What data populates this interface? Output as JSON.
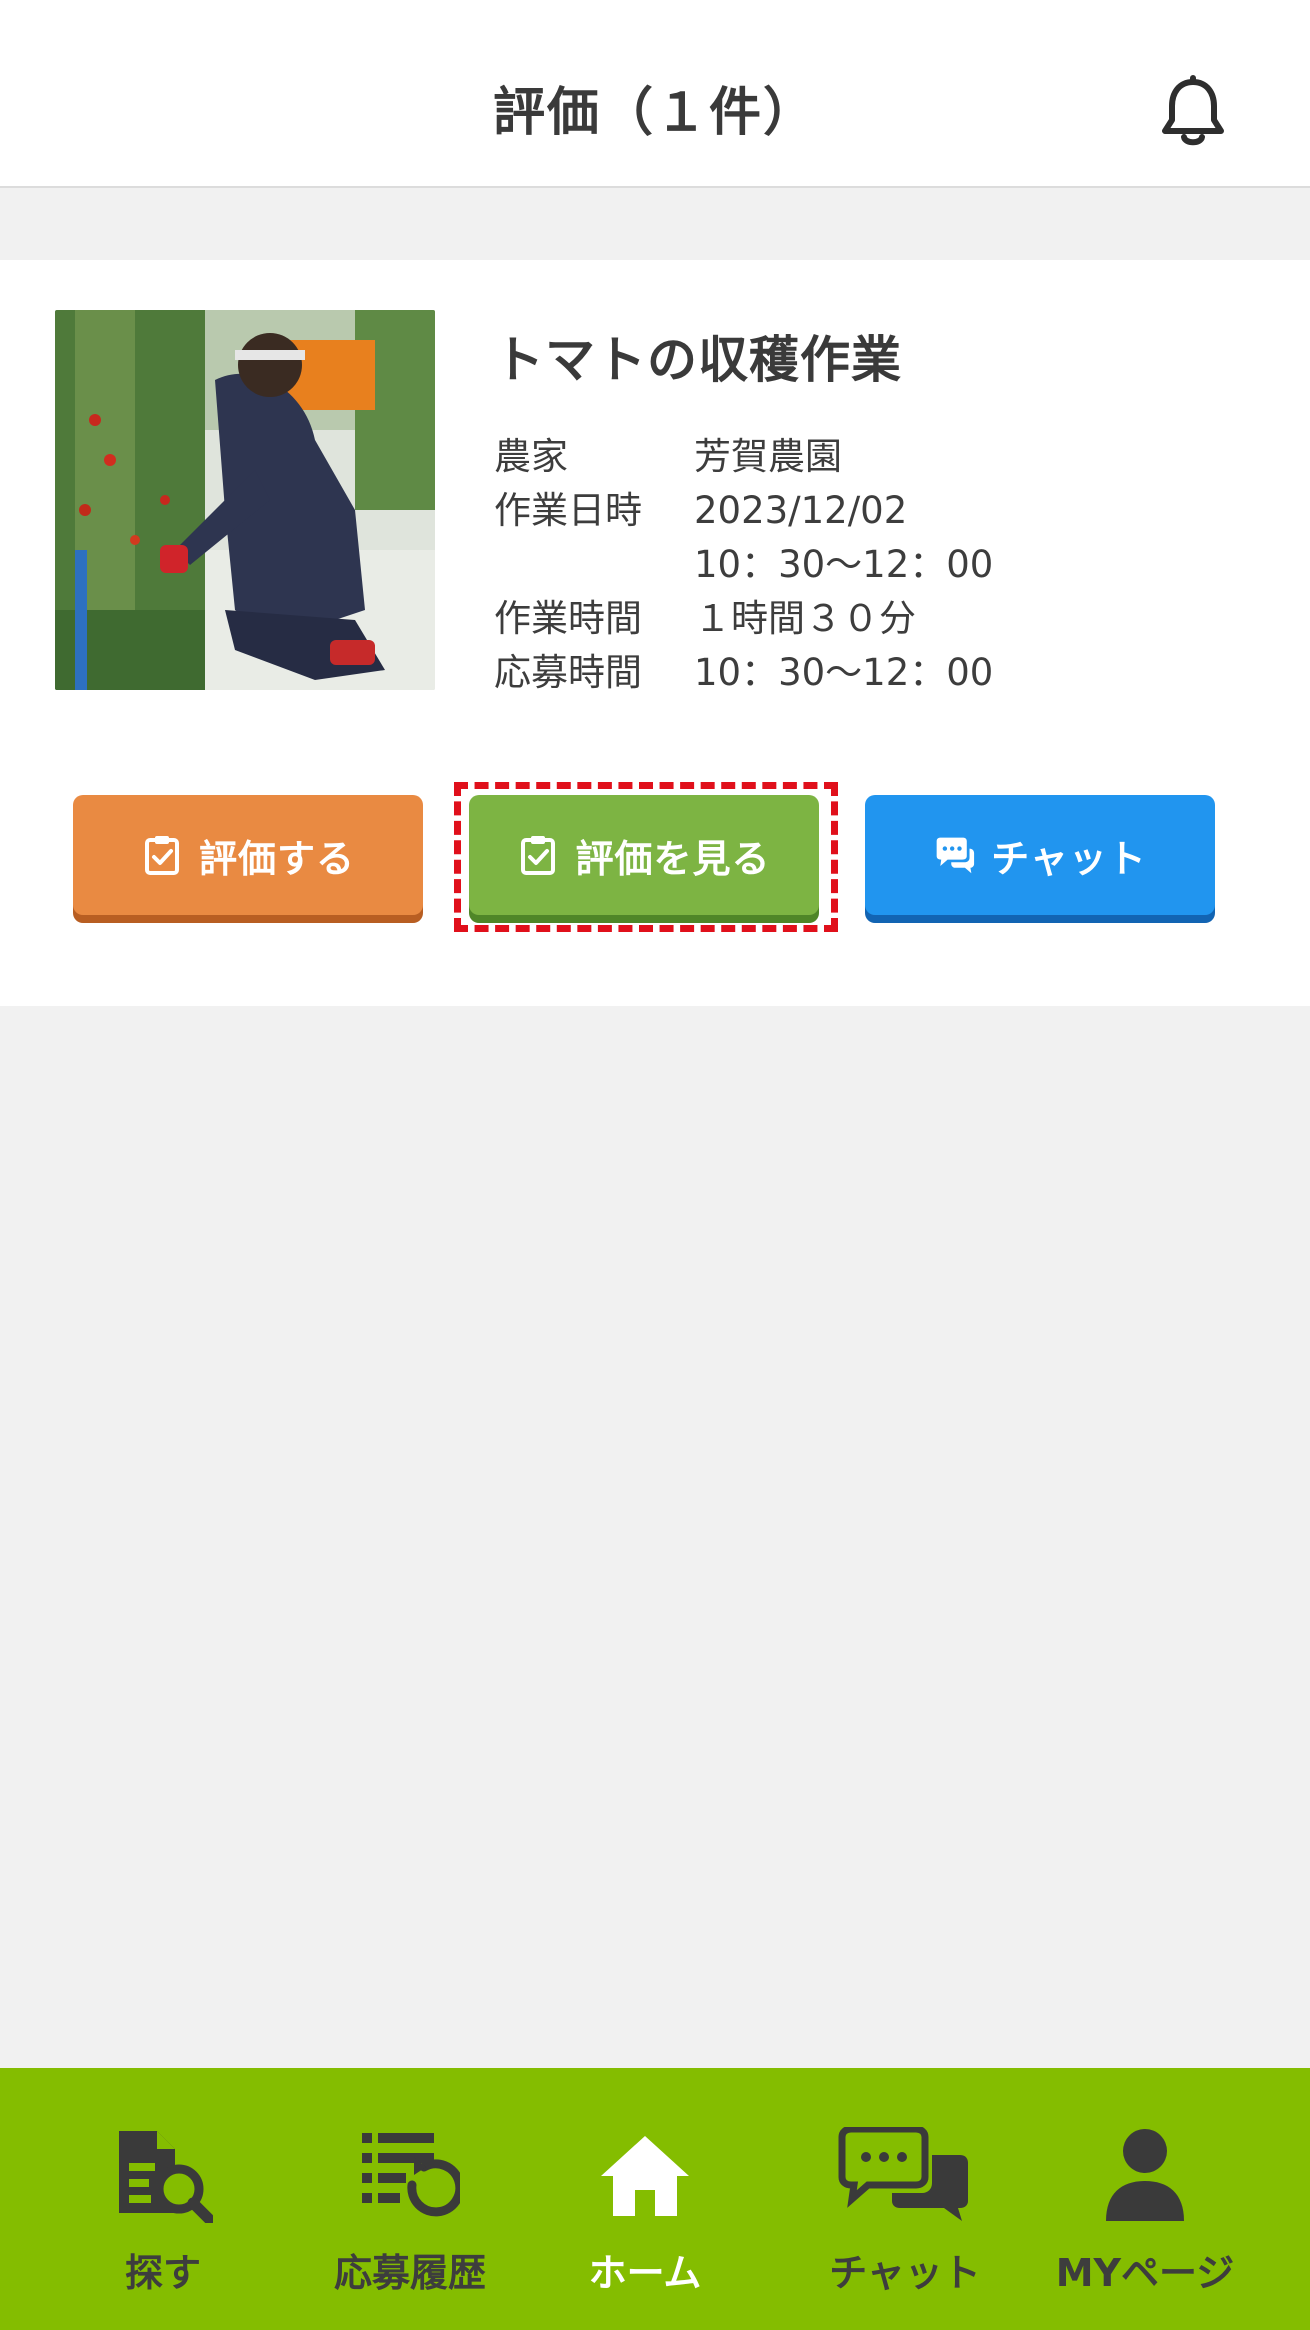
{
  "header": {
    "title": "評価（１件）",
    "notification_icon": "bell-icon"
  },
  "job": {
    "title": "トマトの収穫作業",
    "image_alt": "tomato-harvest-photo",
    "details": [
      {
        "key": "農家",
        "value": "芳賀農園",
        "value2": ""
      },
      {
        "key": "作業日時",
        "value": "2023/12/02",
        "value2": "10：30〜12：00"
      },
      {
        "key": "作業時間",
        "value": "１時間３０分",
        "value2": ""
      },
      {
        "key": "応募時間",
        "value": "10：30〜12：00",
        "value2": ""
      }
    ],
    "buttons": {
      "evaluate": "評価する",
      "view_evaluation": "評価を見る",
      "chat": "チャット"
    }
  },
  "nav": {
    "items": [
      {
        "label": "探す",
        "icon": "search-document-icon"
      },
      {
        "label": "応募履歴",
        "icon": "history-list-icon"
      },
      {
        "label": "ホーム",
        "icon": "home-icon"
      },
      {
        "label": "チャット",
        "icon": "chat-bubbles-icon"
      },
      {
        "label": "MYページ",
        "icon": "user-icon"
      }
    ],
    "active_index": 2
  },
  "colors": {
    "orange": "#e98a42",
    "green": "#7db443",
    "blue": "#2195ef",
    "nav_bg": "#84bd00",
    "highlight": "#e0101b"
  }
}
